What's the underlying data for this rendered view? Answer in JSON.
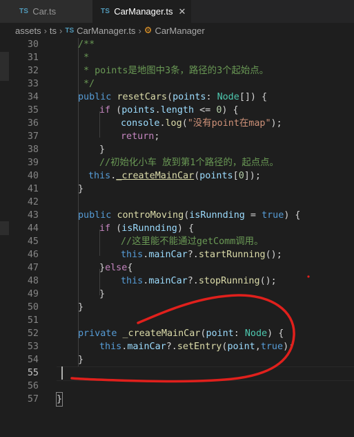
{
  "tabs": [
    {
      "type": "TS",
      "label": "Car.ts",
      "active": false
    },
    {
      "type": "TS",
      "label": "CarManager.ts",
      "active": true,
      "close": "✕"
    }
  ],
  "breadcrumb": {
    "folder1": "assets",
    "folder2": "ts",
    "file_type": "TS",
    "file": "CarManager.ts",
    "symbol": "CarManager"
  },
  "lines": [
    {
      "n": "30"
    },
    {
      "n": "31"
    },
    {
      "n": "32"
    },
    {
      "n": "33"
    },
    {
      "n": "34"
    },
    {
      "n": "35"
    },
    {
      "n": "36"
    },
    {
      "n": "37"
    },
    {
      "n": "38"
    },
    {
      "n": "39"
    },
    {
      "n": "40"
    },
    {
      "n": "41"
    },
    {
      "n": "42"
    },
    {
      "n": "43"
    },
    {
      "n": "44"
    },
    {
      "n": "45"
    },
    {
      "n": "46"
    },
    {
      "n": "47"
    },
    {
      "n": "48"
    },
    {
      "n": "49"
    },
    {
      "n": "50"
    },
    {
      "n": "51"
    },
    {
      "n": "52"
    },
    {
      "n": "53"
    },
    {
      "n": "54"
    },
    {
      "n": "55"
    },
    {
      "n": "56"
    },
    {
      "n": "57"
    }
  ],
  "code": {
    "l30": "/**",
    "l31": "*",
    "l32": "* points是地图中3条，路径的3个起始点。",
    "l33": "*/",
    "l34_k": "public",
    "l34_f": "resetCars",
    "l34_v": "points",
    "l34_t": "Node",
    "l35_k": "if",
    "l35_v1": "points",
    "l35_v2": "length",
    "l35_n": "0",
    "l36_v": "console",
    "l36_f": "log",
    "l36_s": "\"没有point在map\"",
    "l37_k": "return",
    "l39_c": "//初始化小车 放到第1个路径的，起点点。",
    "l40_k": "this",
    "l40_f": "_createMainCar",
    "l40_v": "points",
    "l40_n": "0",
    "l43_k": "public",
    "l43_f": "controMoving",
    "l43_v": "isRunnding",
    "l43_b": "true",
    "l44_k": "if",
    "l44_v": "isRunnding",
    "l45_c": "//这里能不能通过getComm调用。",
    "l46_k": "this",
    "l46_v": "mainCar",
    "l46_f": "startRunning",
    "l47_k": "else",
    "l48_k": "this",
    "l48_v": "mainCar",
    "l48_f": "stopRunning",
    "l52_k": "private",
    "l52_f": "_createMainCar",
    "l52_v": "point",
    "l52_t": "Node",
    "l53_k": "this",
    "l53_v1": "mainCar",
    "l53_f": "setEntry",
    "l53_v2": "point",
    "l53_b": "true"
  },
  "annotation_color": "#e0201c"
}
